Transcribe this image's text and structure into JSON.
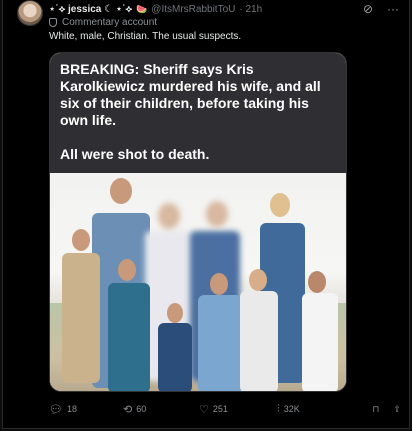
{
  "post": {
    "author_name": "⋆˙⟡ jessica ☾ ⋆˙⟡",
    "author_emoji": "🍉",
    "handle": "@ItsMrsRabbitToU",
    "time": "· 21h",
    "label": "Commentary account",
    "text": "White, male, Christian. The usual suspects."
  },
  "media": {
    "headline_line1": "BREAKING: Sheriff says Kris Karolkiewicz murdered his wife, and all six of their children, before taking his own life.",
    "headline_line2": "All were shot to death."
  },
  "actions": {
    "replies": "18",
    "reposts": "60",
    "likes": "251",
    "views": "32K"
  },
  "icons": {
    "reply": "reply-icon",
    "repost": "repost-icon",
    "like": "heart-icon",
    "views": "views-icon",
    "bookmark": "bookmark-icon",
    "share": "share-icon"
  }
}
